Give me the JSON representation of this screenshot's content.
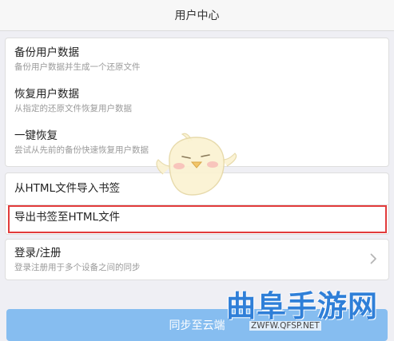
{
  "header": {
    "title": "用户中心"
  },
  "data_section": {
    "items": [
      {
        "title": "备份用户数据",
        "subtitle": "备份用户数据并生成一个还原文件"
      },
      {
        "title": "恢复用户数据",
        "subtitle": "从指定的还原文件恢复用户数据"
      },
      {
        "title": "一键恢复",
        "subtitle": "尝试从先前的备份快速恢复用户数据"
      }
    ]
  },
  "bookmark_section": {
    "items": [
      {
        "title": "从HTML文件导入书签"
      },
      {
        "title": "导出书签至HTML文件",
        "highlighted": true
      }
    ]
  },
  "account_section": {
    "title": "登录/注册",
    "subtitle": "登录注册用于多个设备之间的同步",
    "icon": "chevron-right-icon"
  },
  "sync_button": {
    "label": "同步至云端"
  },
  "watermark": {
    "logo_text": "曲阜手游网",
    "url": "ZWFW.QFSP.NET"
  },
  "colors": {
    "background": "#efeff4",
    "highlight_border": "#e23b3b",
    "sync_button": "#86bdf0",
    "watermark_text": "#2f7fd8"
  }
}
